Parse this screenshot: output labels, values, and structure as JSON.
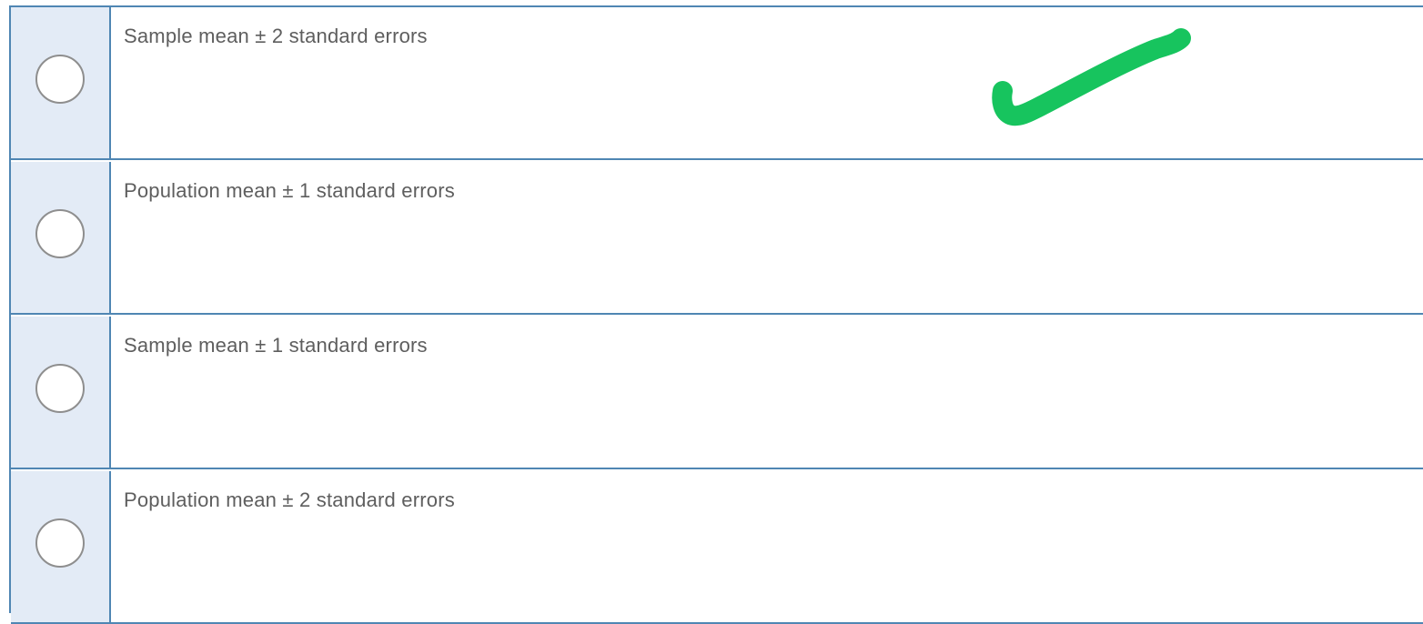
{
  "question": {
    "options": [
      {
        "label": "Sample mean ± 2 standard errors",
        "marked_correct": true
      },
      {
        "label": "Population mean ± 1 standard errors",
        "marked_correct": false
      },
      {
        "label": "Sample mean ± 1 standard errors",
        "marked_correct": false
      },
      {
        "label": "Population mean ± 2 standard errors",
        "marked_correct": false
      }
    ]
  },
  "colors": {
    "border": "#4f86b3",
    "radio_column_bg": "#e3ebf6",
    "label_text": "#5e5e5e",
    "checkmark": "#17c45e"
  },
  "annotations": {
    "checkmark_icon": "green-handwritten-checkmark"
  }
}
